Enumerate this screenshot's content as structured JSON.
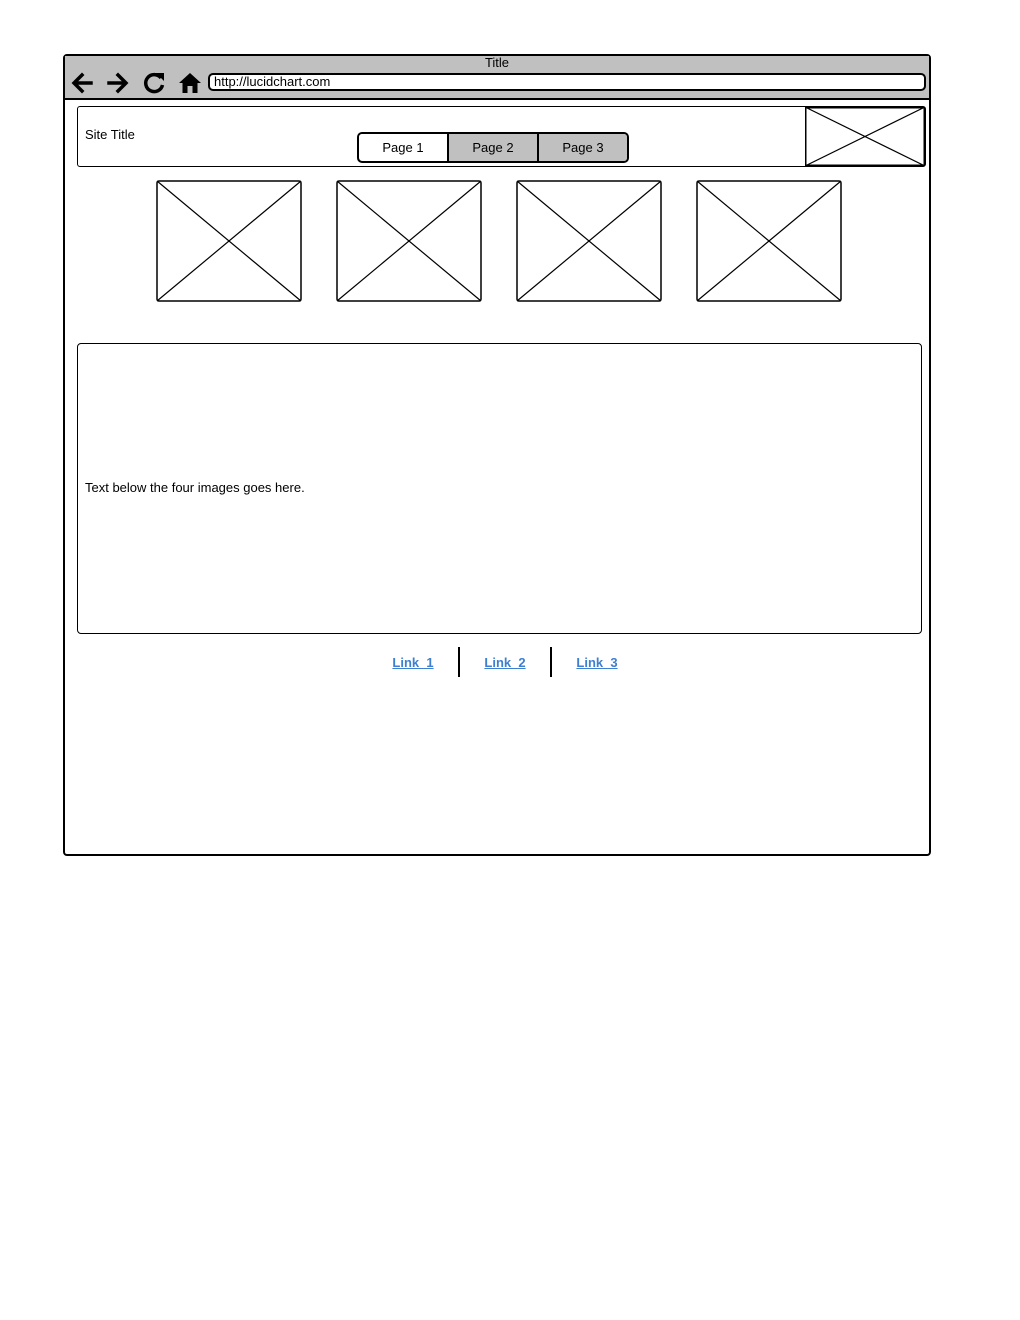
{
  "window": {
    "title": "Title",
    "url": "http://lucidchart.com"
  },
  "nav": {
    "back_icon": "arrow-left-icon",
    "forward_icon": "arrow-right-icon",
    "reload_icon": "reload-icon",
    "home_icon": "home-icon"
  },
  "header": {
    "site_title": "Site Title",
    "tabs": [
      {
        "label": "Page 1",
        "active": true
      },
      {
        "label": "Page 2",
        "active": false
      },
      {
        "label": "Page 3",
        "active": false
      }
    ]
  },
  "images": {
    "count": 4
  },
  "content": {
    "text": "Text below the four images goes here."
  },
  "footer": {
    "links": [
      {
        "label": "Link_1"
      },
      {
        "label": "Link_2"
      },
      {
        "label": "Link_3"
      }
    ]
  },
  "colors": {
    "chrome": "#c0c0c0",
    "link": "#3d7fd1"
  }
}
